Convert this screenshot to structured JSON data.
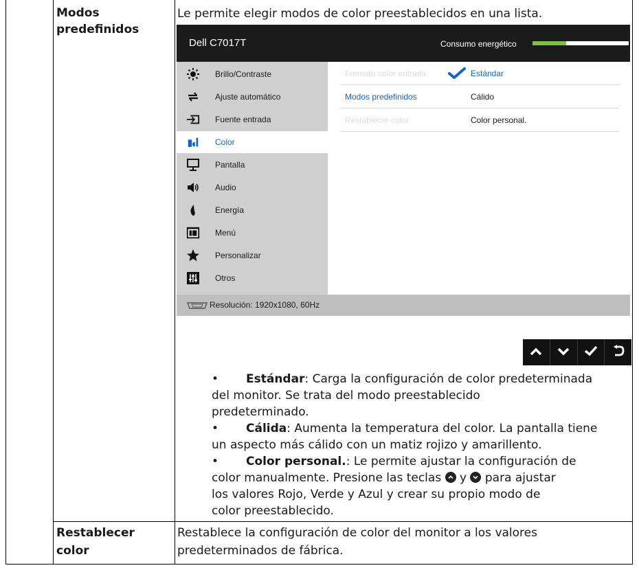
{
  "rows": [
    {
      "term_line1": "Modos",
      "term_line2": "predefinidos",
      "description": "Le permite elegir modos de color preestablecidos en una lista."
    },
    {
      "term_line1": "Restablecer",
      "term_line2": "color",
      "description_line1": "Restablece la configuración de color del monitor a los valores",
      "description_line2": "predeterminados de fábrica."
    }
  ],
  "osd": {
    "model": "Dell C7017T",
    "energy_label": "Consumo energético",
    "energy_level": 0.35,
    "menu_items": [
      {
        "label": "Brillo/Contraste",
        "icon": "brightness-icon"
      },
      {
        "label": "Ajuste  automático",
        "icon": "auto-adjust-icon"
      },
      {
        "label": "Fuente entrada",
        "icon": "input-source-icon"
      },
      {
        "label": "Color",
        "icon": "color-icon",
        "selected": true
      },
      {
        "label": "Pantalla",
        "icon": "display-icon"
      },
      {
        "label": "Audio",
        "icon": "audio-icon"
      },
      {
        "label": "Energía",
        "icon": "energy-icon"
      },
      {
        "label": "Menú",
        "icon": "menu-icon"
      },
      {
        "label": "Personalizar",
        "icon": "star-icon"
      },
      {
        "label": "Otros",
        "icon": "others-icon"
      }
    ],
    "submenu": [
      {
        "key": "Formato color entrada",
        "value": "Estándar",
        "checked": true
      },
      {
        "key": "Modos predefinidos",
        "value": "Cálido"
      },
      {
        "key": "Restablecer color",
        "value": "Color personal."
      }
    ],
    "resolution": "Resolución: 1920x1080, 60Hz",
    "colors": {
      "accent": "#1565c0",
      "energy": "#7ac142",
      "header": "#1b1b1b",
      "menu": "#cfcfcf"
    }
  },
  "buttons": [
    {
      "name": "up-button",
      "icon": "chevron-up-icon"
    },
    {
      "name": "down-button",
      "icon": "chevron-down-icon"
    },
    {
      "name": "ok-button",
      "icon": "check-icon"
    },
    {
      "name": "back-button",
      "icon": "back-icon"
    }
  ],
  "bullets": [
    {
      "bullet": "•",
      "bold": "Estándar",
      "lines": [
        ": Carga la configuración de color predeterminada",
        "del monitor. Se trata del modo preestablecido",
        "predeterminado."
      ]
    },
    {
      "bullet": "•",
      "bold": "Cálida",
      "lines": [
        ": Aumenta la temperatura del color. La pantalla tiene",
        "un aspecto más cálido con un matiz rojizo y amarillento."
      ]
    },
    {
      "bullet": "•",
      "bold": "Color personal.",
      "line1": ": Le permite ajustar la configuración de",
      "line2a": "color manualmente. Presione las teclas",
      "line2b": "y",
      "line2c": "para ajustar",
      "line3": "los valores Rojo, Verde y Azul y crear su propio modo de",
      "line4": "color preestablecido."
    }
  ]
}
